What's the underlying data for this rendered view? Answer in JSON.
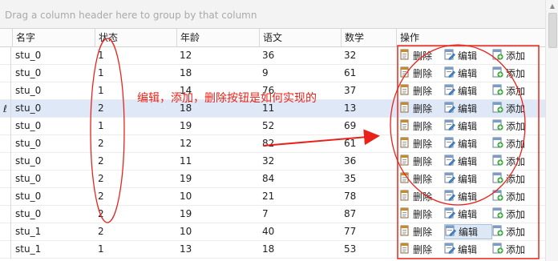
{
  "group_panel": {
    "hint": "Drag a column header here to group by that column"
  },
  "columns": [
    "名字",
    "状态",
    "年龄",
    "语文",
    "数学",
    "操作"
  ],
  "op_labels": {
    "delete": "删除",
    "edit": "编辑",
    "add": "添加"
  },
  "focused_row_index": 3,
  "focused_indicator": "ℓ",
  "pressed_edit_row_index": 10,
  "rows": [
    {
      "name": "stu_0",
      "status": "1",
      "age": "12",
      "chinese": "36",
      "math": "32"
    },
    {
      "name": "stu_0",
      "status": "1",
      "age": "18",
      "chinese": "9",
      "math": "61"
    },
    {
      "name": "stu_0",
      "status": "1",
      "age": "14",
      "chinese": "76",
      "math": "37"
    },
    {
      "name": "stu_0",
      "status": "2",
      "age": "18",
      "chinese": "11",
      "math": "13"
    },
    {
      "name": "stu_0",
      "status": "1",
      "age": "19",
      "chinese": "52",
      "math": "69"
    },
    {
      "name": "stu_0",
      "status": "2",
      "age": "12",
      "chinese": "82",
      "math": "61"
    },
    {
      "name": "stu_0",
      "status": "2",
      "age": "11",
      "chinese": "32",
      "math": "36"
    },
    {
      "name": "stu_0",
      "status": "2",
      "age": "19",
      "chinese": "84",
      "math": "35"
    },
    {
      "name": "stu_0",
      "status": "2",
      "age": "10",
      "chinese": "21",
      "math": "78"
    },
    {
      "name": "stu_0",
      "status": "2",
      "age": "19",
      "chinese": "7",
      "math": "87"
    },
    {
      "name": "stu_1",
      "status": "2",
      "age": "10",
      "chinese": "40",
      "math": "77"
    },
    {
      "name": "stu_1",
      "status": "1",
      "age": "13",
      "chinese": "18",
      "math": "53"
    }
  ],
  "annotation": {
    "text": "编辑，添加，删除按钮是如何实现的"
  },
  "colors": {
    "annotation": "#e8231b",
    "focused_row": "#dfe8f7",
    "header_bg": "#fbfbfb"
  }
}
